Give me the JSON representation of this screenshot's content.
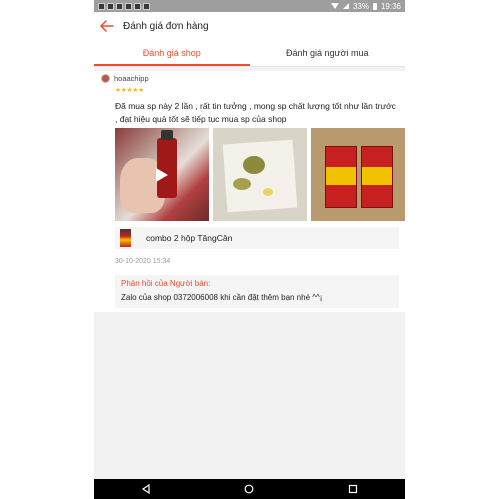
{
  "status_bar": {
    "battery": "33%",
    "time": "19:36"
  },
  "header": {
    "title": "Đánh giá đơn hàng",
    "back_icon": "arrow-left-icon"
  },
  "tabs": [
    {
      "label": "Đánh giá shop",
      "active": true
    },
    {
      "label": "Đánh giá người mua",
      "active": false
    }
  ],
  "review": {
    "username": "hoaachipp",
    "stars": "★★★★★",
    "rating": 5,
    "text": "Đã mua sp này 2 lần , rất tin tưởng , mong sp chất lượng tốt như lần trước , đạt hiệu quả tốt sẽ tiếp tục mua sp của shop",
    "media": [
      {
        "type": "video",
        "icon": "play-icon"
      },
      {
        "type": "image"
      },
      {
        "type": "image"
      }
    ],
    "product_name": "combo 2 hộp TăngCân",
    "date": "30-10-2020 15:34",
    "seller_reply": {
      "label": "Phản hồi của Người bán:",
      "text": "Zalo của shop 0372006008 khi cần đặt thêm bạn nhé ^^¡"
    }
  },
  "colors": {
    "accent": "#ee4d2d",
    "star": "#f5b400"
  }
}
